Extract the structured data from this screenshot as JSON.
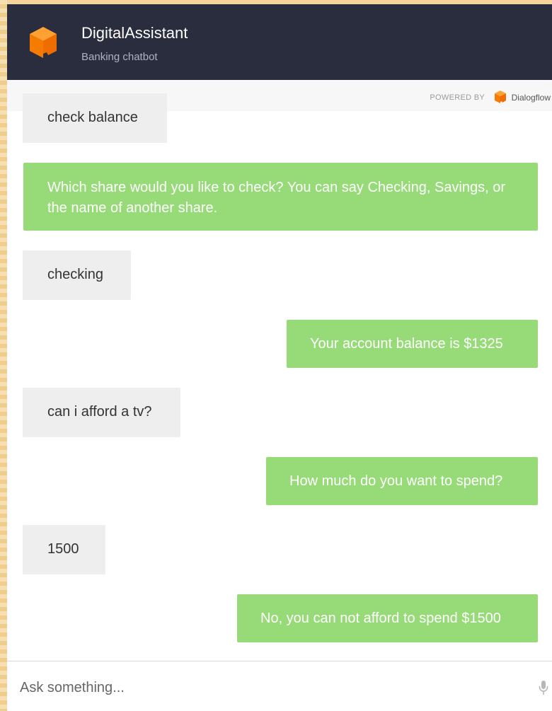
{
  "header": {
    "title": "DigitalAssistant",
    "subtitle": "Banking chatbot",
    "brand_color": "#2a2d3d",
    "logo_icon": "cube-logo-icon"
  },
  "powered_by": {
    "label": "POWERED BY",
    "brand": "Dialogflow",
    "brand_icon": "dialogflow-logo-icon"
  },
  "messages": [
    {
      "from": "user",
      "text": "check balance"
    },
    {
      "from": "bot",
      "text": "Which share would you like to check? You can say Checking, Savings, or the name of another share."
    },
    {
      "from": "user",
      "text": "checking"
    },
    {
      "from": "bot",
      "text": "Your account balance is $1325"
    },
    {
      "from": "user",
      "text": "can i afford a tv?"
    },
    {
      "from": "bot",
      "text": "How much do you want to spend?"
    },
    {
      "from": "user",
      "text": "1500"
    },
    {
      "from": "bot",
      "text": "No, you can not afford to spend $1500"
    }
  ],
  "colors": {
    "bot_bubble": "#97da78",
    "user_bubble": "#eeeeee",
    "accent_orange": "#f57c00"
  },
  "composer": {
    "placeholder": "Ask something...",
    "value": "",
    "mic_icon": "microphone-icon"
  }
}
